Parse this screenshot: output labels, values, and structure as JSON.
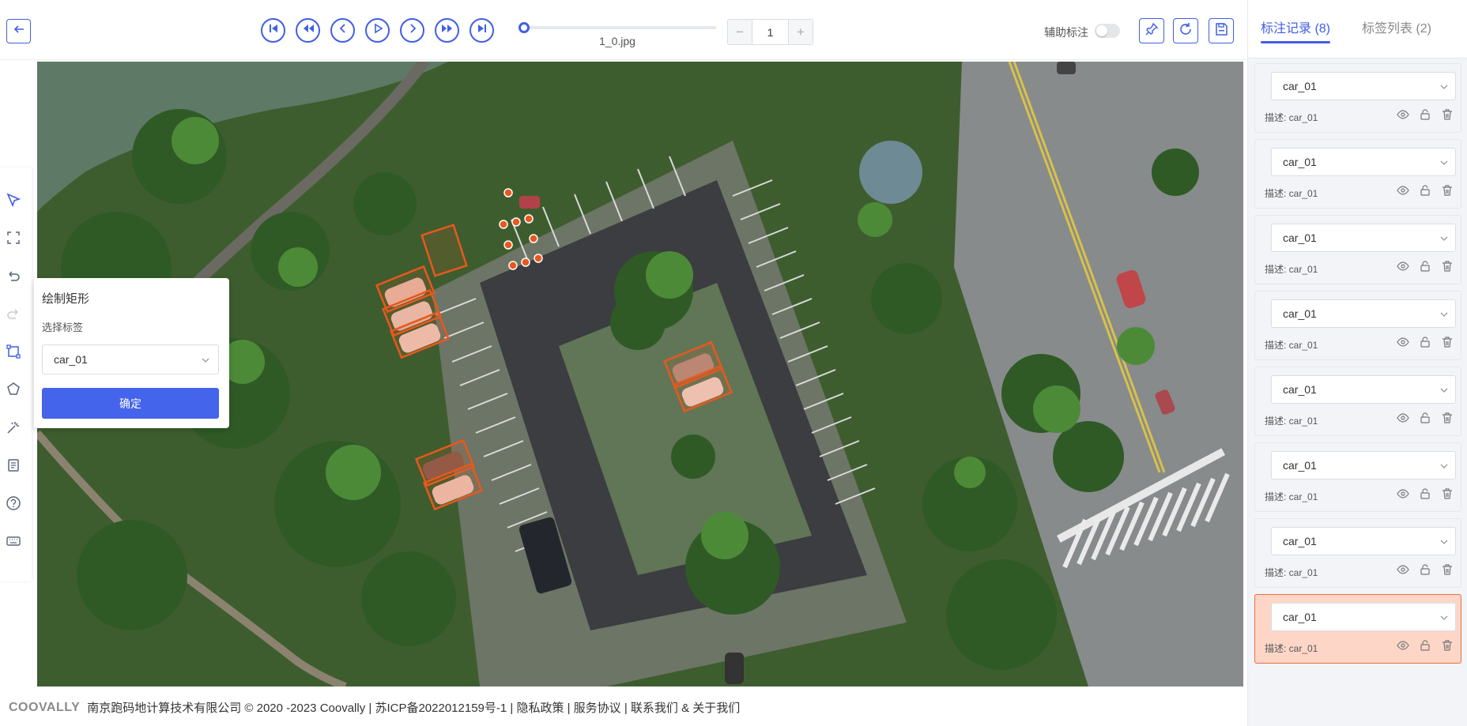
{
  "toolbar": {
    "file_name": "1_0.jpg",
    "frame_value": "1",
    "minus_label": "−",
    "plus_label": "+",
    "aux_label": "辅助标注"
  },
  "draw_panel": {
    "title": "绘制矩形",
    "select_label": "选择标签",
    "selected_label": "car_01",
    "confirm_label": "确定"
  },
  "right_panel": {
    "tab_records": "标注记录 (8)",
    "tab_labels": "标签列表 (2)",
    "records": [
      {
        "label": "car_01",
        "desc": "描述: car_01"
      },
      {
        "label": "car_01",
        "desc": "描述: car_01"
      },
      {
        "label": "car_01",
        "desc": "描述: car_01"
      },
      {
        "label": "car_01",
        "desc": "描述: car_01"
      },
      {
        "label": "car_01",
        "desc": "描述: car_01"
      },
      {
        "label": "car_01",
        "desc": "描述: car_01"
      },
      {
        "label": "car_01",
        "desc": "描述: car_01"
      },
      {
        "label": "car_01",
        "desc": "描述: car_01"
      }
    ]
  },
  "footer": {
    "brand": "COOVALLY",
    "text": "南京跑码地计算技术有限公司 © 2020 -2023 Coovally | 苏ICP备2022012159号-1 | 隐私政策 | 服务协议 | 联系我们 & 关于我们"
  },
  "colors": {
    "accent": "#3f5fe8",
    "annotation": "#e8581e",
    "highlight_bg": "#fdd6c8"
  },
  "icons": [
    "back-icon",
    "skip-first-icon",
    "fast-backward-icon",
    "prev-icon",
    "play-icon",
    "next-icon",
    "fast-forward-icon",
    "skip-last-icon",
    "pin-icon",
    "refresh-icon",
    "save-icon",
    "select-icon",
    "rectangle-icon",
    "undo-icon",
    "redo-icon",
    "crop-icon",
    "polygon-icon",
    "magic-wand-icon",
    "document-icon",
    "help-icon",
    "keyboard-icon",
    "eye-icon",
    "lock-icon",
    "trash-icon",
    "chevron-down-icon"
  ]
}
